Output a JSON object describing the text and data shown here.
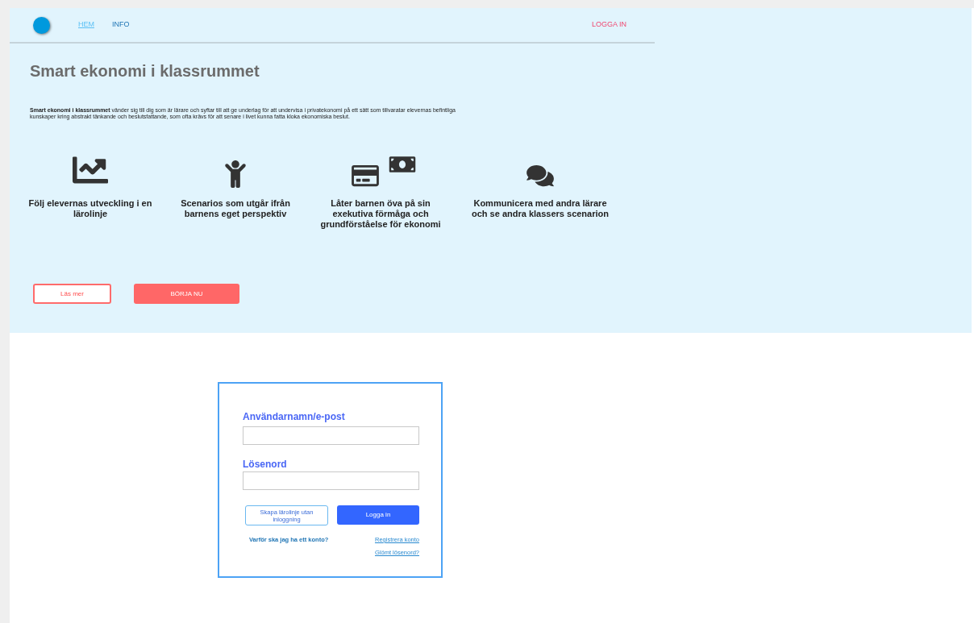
{
  "nav": {
    "items": [
      {
        "label": "HEM",
        "selected": true
      },
      {
        "label": "INFO",
        "selected": false
      }
    ],
    "login_link": "LOGGA IN"
  },
  "hero": {
    "title": "Smart ekonomi i klassrummet",
    "description": "**Smart ekonomi i klassrummet** vänder sig till dig som är lärare och syftar till att ge underlag för att undervisa i privatekonomi på ett sätt som tillvaratar elevernas befintliga kunskaper kring abstrakt tänkande och beslutsfattande, som ofta krävs för att senare i livet kunna fatta kloka ekonomiska beslut.",
    "features": [
      {
        "text": "Följ elevernas utveckling i en lärolinje"
      },
      {
        "text": "Scenarios som utgår ifrån barnens eget perspektiv"
      },
      {
        "text": "Låter barnen öva på sin exekutiva förmåga och grundförståelse för ekonomi"
      },
      {
        "text": "Kommunicera med andra lärare och se andra klassers scenarion"
      }
    ],
    "buttons": [
      {
        "label": "Läs mer",
        "kind": "outline"
      },
      {
        "label": "BÖRJA NU",
        "kind": "filled"
      }
    ]
  },
  "login": {
    "username_label": "Användarnamn/e-post",
    "password_label": "Lösenord",
    "guest_button": "Skapa lärolinje utan inloggning",
    "login_button": "Logga in",
    "why_link": "Varför ska jag ha ett konto?",
    "register_link": "Registrera konto",
    "forgot_link": "Glömt lösenord?"
  }
}
